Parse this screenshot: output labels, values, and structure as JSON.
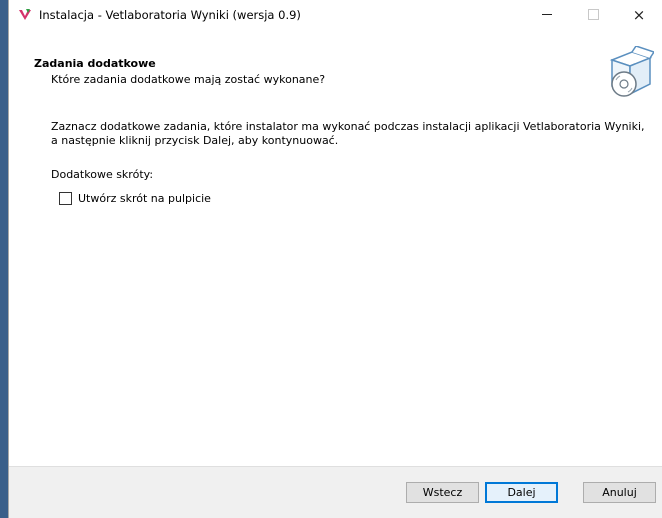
{
  "window": {
    "title": "Instalacja - Vetlaboratoria Wyniki (wersja 0.9)",
    "icon": "installer-app-icon",
    "controls": {
      "minimize": "minimize-icon",
      "maximize": "maximize-icon",
      "close": "×"
    }
  },
  "header": {
    "title": "Zadania dodatkowe",
    "subtitle": "Które zadania dodatkowe mają zostać wykonane?",
    "icon": "setup-box-icon"
  },
  "content": {
    "description_line1": "Zaznacz dodatkowe zadania, które instalator ma wykonać podczas instalacji aplikacji Vetlaboratoria Wyniki,",
    "description_line2": "a następnie kliknij przycisk Dalej, aby kontynuować.",
    "group_label": "Dodatkowe skróty:",
    "checkbox": {
      "label": "Utwórz skrót na pulpicie",
      "checked": false
    }
  },
  "footer": {
    "back_label": "Wstecz",
    "next_label": "Dalej",
    "cancel_label": "Anuluj"
  },
  "colors": {
    "accent": "#0078d7",
    "footer_bg": "#f0f0f0",
    "button_bg": "#e1e1e1"
  }
}
